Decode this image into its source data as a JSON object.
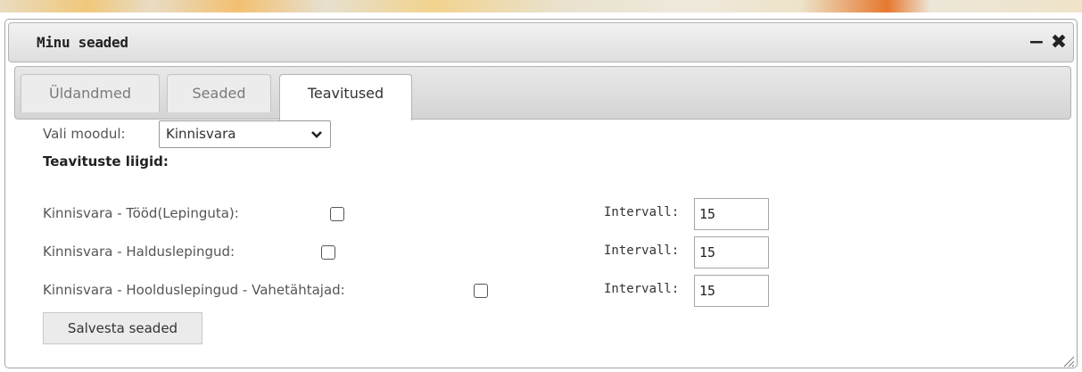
{
  "dialog": {
    "title": "Minu seaded",
    "minimize_icon": "minus-icon",
    "close_icon": "close-icon"
  },
  "tabs": [
    {
      "label": "Üldandmed",
      "active": false
    },
    {
      "label": "Seaded",
      "active": false
    },
    {
      "label": "Teavitused",
      "active": true
    }
  ],
  "module": {
    "label": "Vali moodul:",
    "selected": "Kinnisvara"
  },
  "section_title": "Teavituste liigid:",
  "notifications": [
    {
      "label": "Kinnisvara - Tööd(Lepinguta):",
      "checked": false,
      "interval_label": "Intervall:",
      "interval_value": "15"
    },
    {
      "label": "Kinnisvara - Halduslepingud:",
      "checked": false,
      "interval_label": "Intervall:",
      "interval_value": "15"
    },
    {
      "label": "Kinnisvara - Hoolduslepingud - Vahetähtajad:",
      "checked": false,
      "interval_label": "Intervall:",
      "interval_value": "15"
    }
  ],
  "save_button": "Salvesta seaded"
}
